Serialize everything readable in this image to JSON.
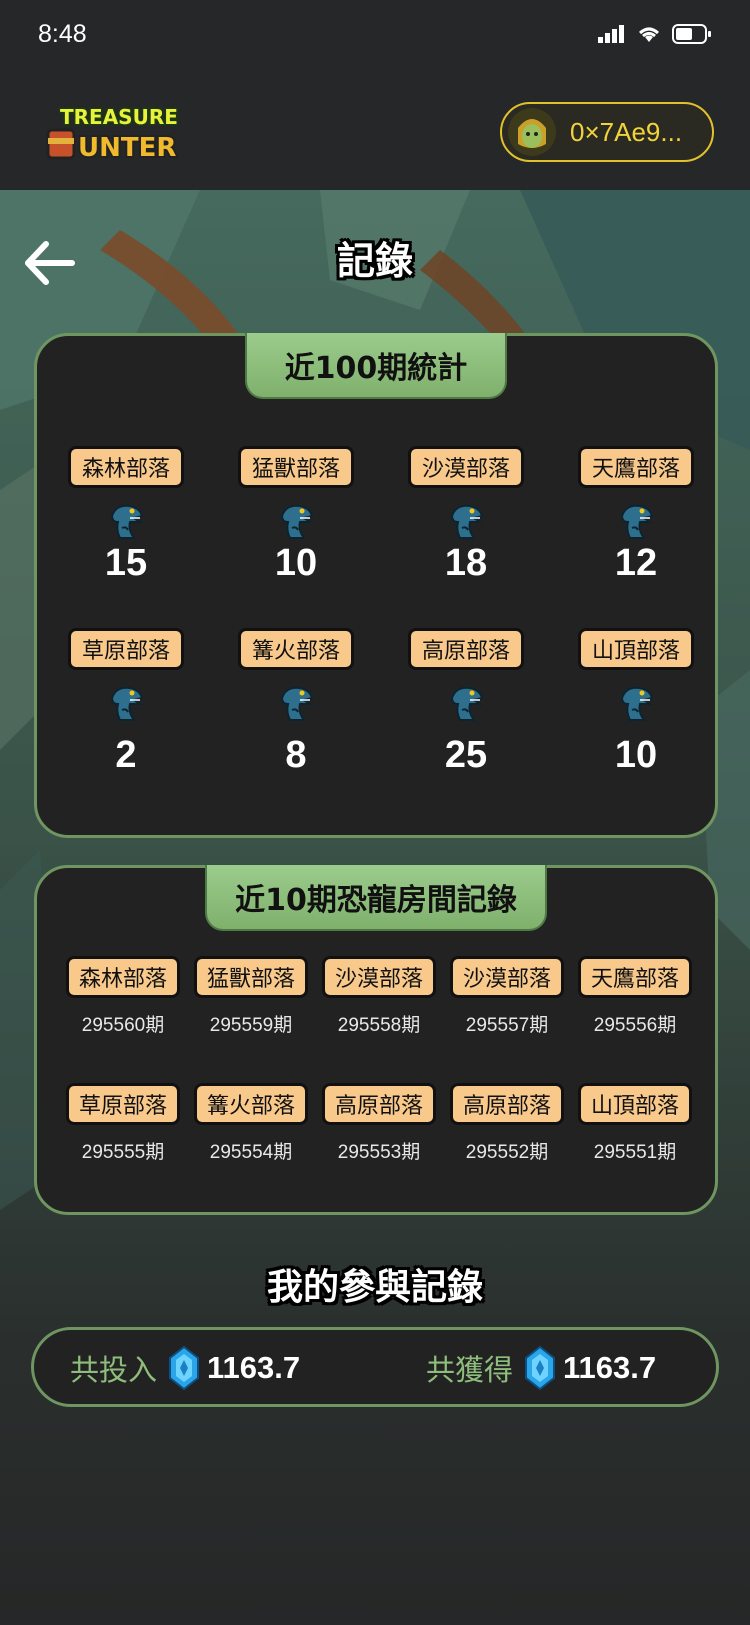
{
  "status_bar": {
    "time": "8:48"
  },
  "header": {
    "logo_alt": "TREASURE HUNTER",
    "wallet_address": "0×7Ae9..."
  },
  "page": {
    "title": "記錄"
  },
  "stats_panel": {
    "title": "近100期統計",
    "items": [
      {
        "tribe": "森林部落",
        "count": "15"
      },
      {
        "tribe": "猛獸部落",
        "count": "10"
      },
      {
        "tribe": "沙漠部落",
        "count": "18"
      },
      {
        "tribe": "天鷹部落",
        "count": "12"
      },
      {
        "tribe": "草原部落",
        "count": "2"
      },
      {
        "tribe": "篝火部落",
        "count": "8"
      },
      {
        "tribe": "高原部落",
        "count": "25"
      },
      {
        "tribe": "山頂部落",
        "count": "10"
      }
    ]
  },
  "history_panel": {
    "title": "近10期恐龍房間記錄",
    "items": [
      {
        "tribe": "森林部落",
        "issue": "295560期"
      },
      {
        "tribe": "猛獸部落",
        "issue": "295559期"
      },
      {
        "tribe": "沙漠部落",
        "issue": "295558期"
      },
      {
        "tribe": "沙漠部落",
        "issue": "295557期"
      },
      {
        "tribe": "天鷹部落",
        "issue": "295556期"
      },
      {
        "tribe": "草原部落",
        "issue": "295555期"
      },
      {
        "tribe": "篝火部落",
        "issue": "295554期"
      },
      {
        "tribe": "高原部落",
        "issue": "295553期"
      },
      {
        "tribe": "高原部落",
        "issue": "295552期"
      },
      {
        "tribe": "山頂部落",
        "issue": "295551期"
      }
    ]
  },
  "my_records": {
    "title": "我的參與記錄",
    "invested_label": "共投入",
    "invested_value": "1163.7",
    "earned_label": "共獲得",
    "earned_value": "1163.7"
  },
  "colors": {
    "accent_green": "#7fb06c",
    "tag_bg": "#f8c98b",
    "wallet_border": "#e2c22c"
  },
  "icons": [
    "back-arrow-icon",
    "dino-icon",
    "gem-icon",
    "signal-icon",
    "wifi-icon",
    "battery-icon"
  ]
}
